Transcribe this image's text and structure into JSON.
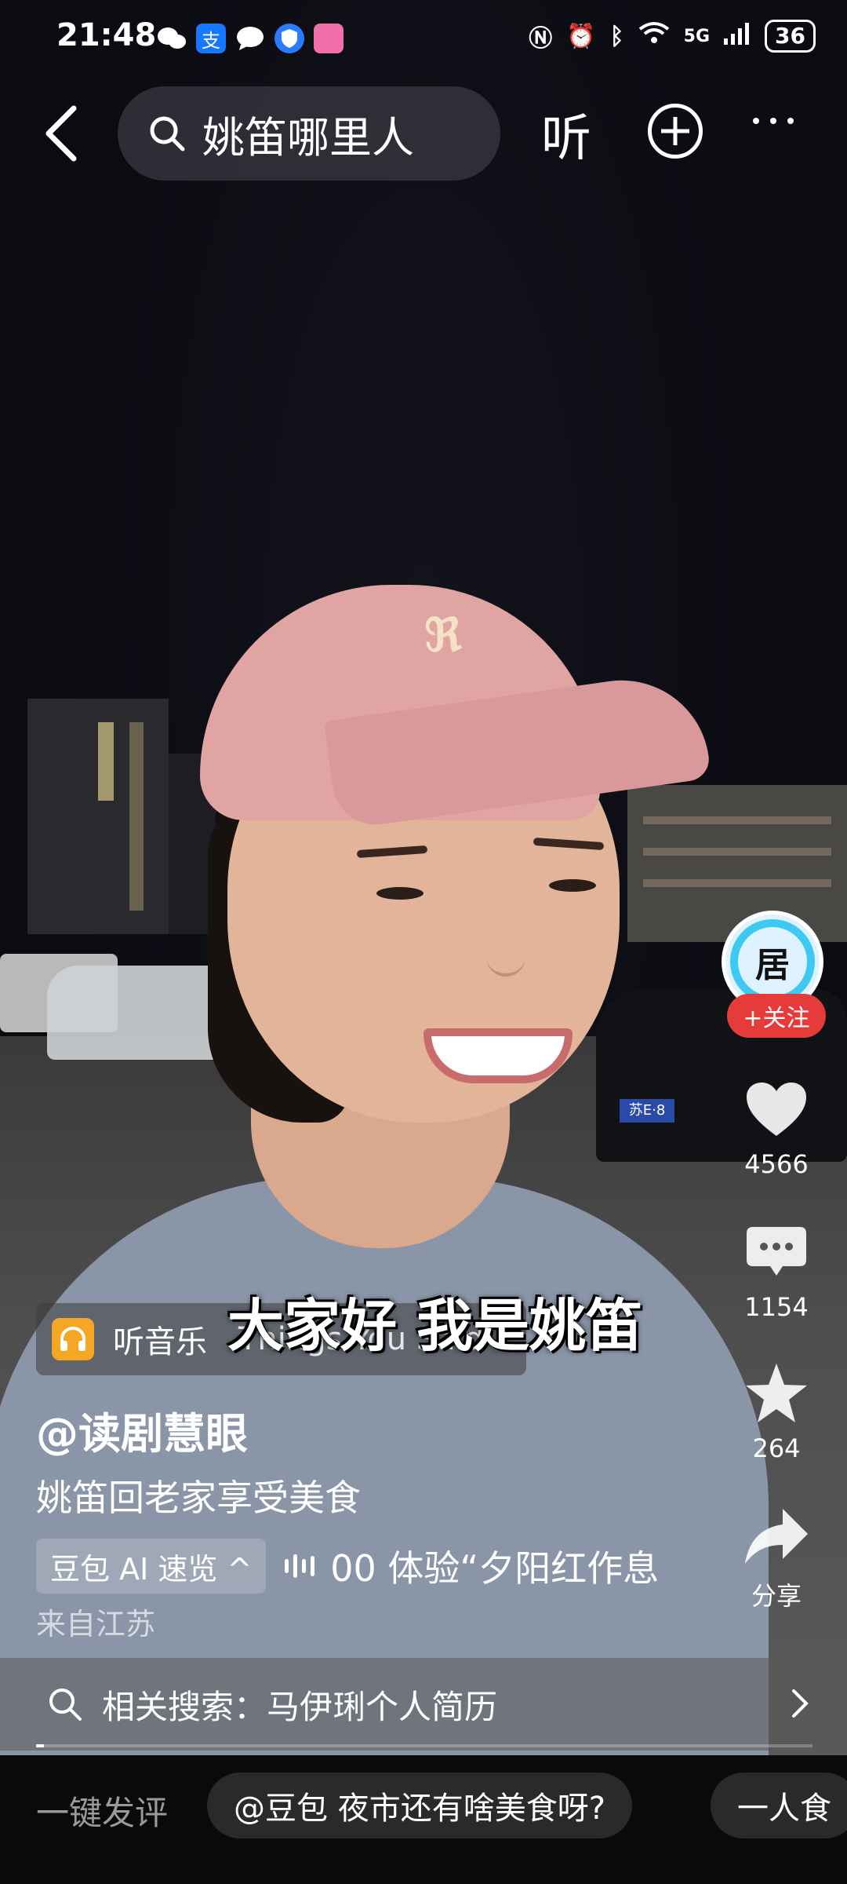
{
  "status_bar": {
    "time": "21:48",
    "battery": "36",
    "network": "5G"
  },
  "top_bar": {
    "search_text": "姚笛哪里人",
    "listen_label": "听"
  },
  "video": {
    "subtitle": "大家好 我是姚笛",
    "plate_text": "苏E·8"
  },
  "creator": {
    "avatar_text": "居",
    "follow_label": "+关注"
  },
  "actions": {
    "likes": "4566",
    "comments": "1154",
    "favorites": "264",
    "share_label": "分享"
  },
  "music": {
    "label": "听音乐",
    "song": "Things You Said"
  },
  "post": {
    "author": "@读剧慧眼",
    "caption": "姚笛回老家享受美食",
    "ai_chip": "豆包 AI 速览 ^",
    "ai_summary": "00 体验“夕阳红作息",
    "location": "来自江苏"
  },
  "related_search": {
    "label": "相关搜索：",
    "query": "马伊琍个人简历"
  },
  "playback": {
    "progress": 0.01
  },
  "bottom_bar": {
    "comment_prompt": "一键发评",
    "chips": [
      "@豆包 夜市还有啥美食呀?",
      "一人食"
    ]
  },
  "colors": {
    "follow_red": "#e63b3b",
    "music_orange": "#f5a623",
    "avatar_ring": "#3dc9f2"
  }
}
